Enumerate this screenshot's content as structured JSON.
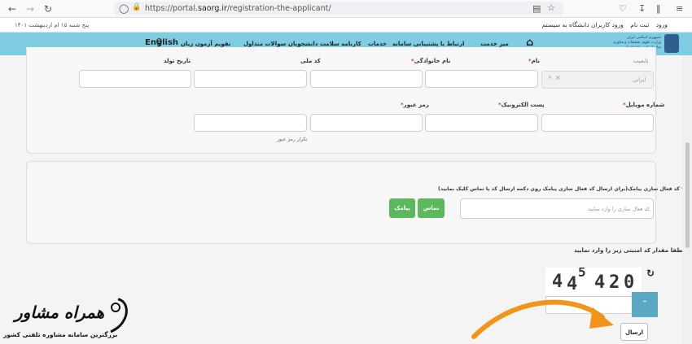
{
  "browser": {
    "url_prefix": "https://portal.",
    "url_domain": "saorg.ir",
    "url_path": "/registration-the-applicant/"
  },
  "topbar": {
    "date": "پنج شنبه ۱۵ ام اردیبهشت ۱۴۰۱",
    "login": "ورود",
    "signup": "ثبت نام",
    "university_login": "ورود کاربران دانشگاه به سیستم"
  },
  "nav": {
    "service_desk": "میز خدمت",
    "support": "ارتباط با پشتیبانی سامانه",
    "services": "خدمات",
    "health_card": "کارنامه سلامت دانشجویان",
    "faq": "سوالات متداول",
    "calendar": "تقویم آزمون زبان",
    "english": "English"
  },
  "logo": {
    "line1": "جمهوری اسلامی ایران",
    "line2": "وزارت علوم، تحقیقات و فناوری",
    "line3": "سازمان امور دانشجویان"
  },
  "form": {
    "nationality_label": "تابعیت",
    "nationality_value": "ایرانی",
    "first_name_label": "نام",
    "last_name_label": "نام خانوادگی",
    "national_code_label": "کد ملی",
    "birth_date_label": "تاریخ تولد",
    "mobile_label": "شماره موبایل",
    "email_label": "پست الکترونیک",
    "password_label": "رمز عبور",
    "password_confirm_hint": "تکرار رمز عبور"
  },
  "activation": {
    "label": "کد فعال سازی پیامک(برای ارسال کد فعال سازی پیامک روی دکمه ارسال کد یا تماس کلیک نمایید)",
    "placeholder": "کد فعال سازی را وارد نمایید",
    "call_button": "تماس",
    "sms_button": "پیامک"
  },
  "captcha": {
    "prompt": "لطفا مقدار کد امنیتی زیر را وارد نمایید",
    "digits": [
      "4",
      "4",
      "5",
      "4",
      "2",
      "0"
    ],
    "submit": "ارسال"
  },
  "watermark": {
    "title": "همراه مشاور",
    "subtitle": "بزرگترین سامانه مشاوره تلفنی کشور"
  },
  "colors": {
    "navbar": "#7fcde3",
    "green_button": "#5cb85c",
    "required": "#e23a3a"
  }
}
